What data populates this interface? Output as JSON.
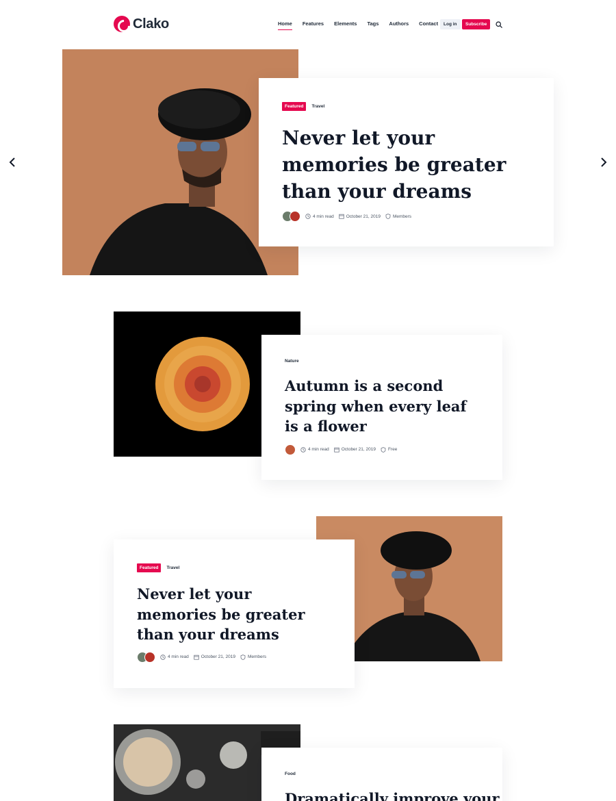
{
  "header": {
    "logo_text": "Clako",
    "nav": [
      {
        "label": "Home",
        "active": true
      },
      {
        "label": "Features",
        "active": false
      },
      {
        "label": "Elements",
        "active": false
      },
      {
        "label": "Tags",
        "active": false
      },
      {
        "label": "Authors",
        "active": false
      },
      {
        "label": "Contact",
        "active": false
      }
    ],
    "login_label": "Log in",
    "subscribe_label": "Subscribe",
    "search_icon": "search-icon"
  },
  "slider": {
    "prev_icon": "chevron-left-icon",
    "next_icon": "chevron-right-icon"
  },
  "colors": {
    "accent": "#e5094f",
    "text": "#111827"
  },
  "posts": [
    {
      "featured_tag": "Featured",
      "tag": "Travel",
      "title": "Never let your memories be greater than your dreams",
      "read_time": "4 min read",
      "date": "October 21, 2019",
      "access": "Members"
    },
    {
      "featured_tag": "",
      "tag": "Nature",
      "title": "Autumn is a second spring when every leaf is a flower",
      "read_time": "4 min read",
      "date": "October 21, 2019",
      "access": "Free"
    },
    {
      "featured_tag": "Featured",
      "tag": "Travel",
      "title": "Never let your memories be greater than your dreams",
      "read_time": "4 min read",
      "date": "October 21, 2019",
      "access": "Members"
    },
    {
      "featured_tag": "",
      "tag": "Food",
      "title": "Dramatically improve your"
    }
  ]
}
